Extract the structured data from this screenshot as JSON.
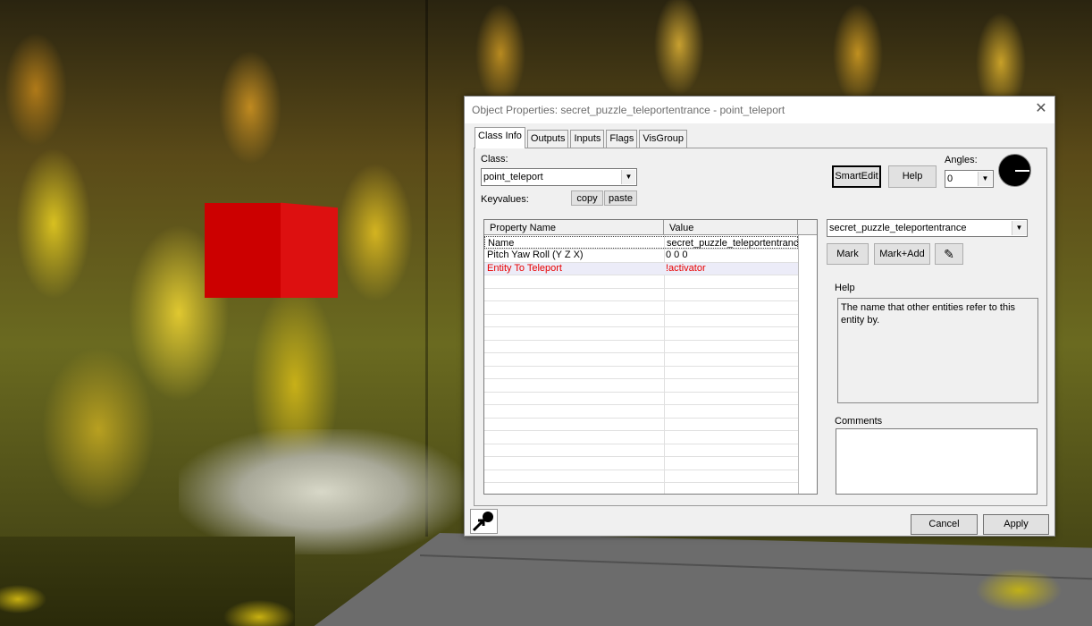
{
  "dialog": {
    "title": "Object Properties: secret_puzzle_teleportentrance - point_teleport",
    "close_glyph": "✕",
    "tabs": [
      {
        "label": "Class Info",
        "active": true
      },
      {
        "label": "Outputs"
      },
      {
        "label": "Inputs"
      },
      {
        "label": "Flags"
      },
      {
        "label": "VisGroup"
      }
    ],
    "class_label": "Class:",
    "class_value": "point_teleport",
    "keyvalues_label": "Keyvalues:",
    "copy_label": "copy",
    "paste_label": "paste",
    "smartedit_label": "SmartEdit",
    "help_button_label": "Help",
    "angles_label": "Angles:",
    "angles_value": "0",
    "grid": {
      "headers": [
        "Property Name",
        "Value"
      ],
      "rows": [
        {
          "name": "Name",
          "value": "secret_puzzle_teleportentrance",
          "selected": true
        },
        {
          "name": "Pitch Yaw Roll (Y Z X)",
          "value": "0 0 0"
        },
        {
          "name": "Entity To Teleport",
          "value": "!activator",
          "highlight": true
        }
      ]
    },
    "value_combo": "secret_puzzle_teleportentrance",
    "mark_label": "Mark",
    "markadd_label": "Mark+Add",
    "eyedropper_icon": "eyedropper-icon",
    "help_section_label": "Help",
    "help_text": "The name that other entities refer to this entity by.",
    "comments_label": "Comments",
    "comments_value": "",
    "cancel_label": "Cancel",
    "apply_label": "Apply",
    "colors": {
      "highlight_text": "#e80000",
      "cube": "#cc0000"
    }
  }
}
